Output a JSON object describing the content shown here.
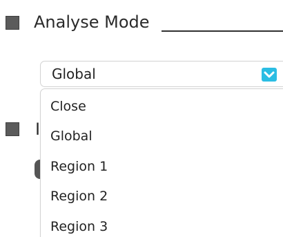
{
  "section": {
    "title": "Analyse Mode"
  },
  "select": {
    "value": "Global",
    "options": [
      "Close",
      "Global",
      "Region 1",
      "Region 2",
      "Region 3"
    ]
  },
  "background": {
    "partial_label": "I"
  },
  "colors": {
    "dropdown_button": "#2bbde3",
    "square_marker": "#5b5b5b"
  },
  "icons": {
    "select_button": "chevron-down-icon"
  }
}
